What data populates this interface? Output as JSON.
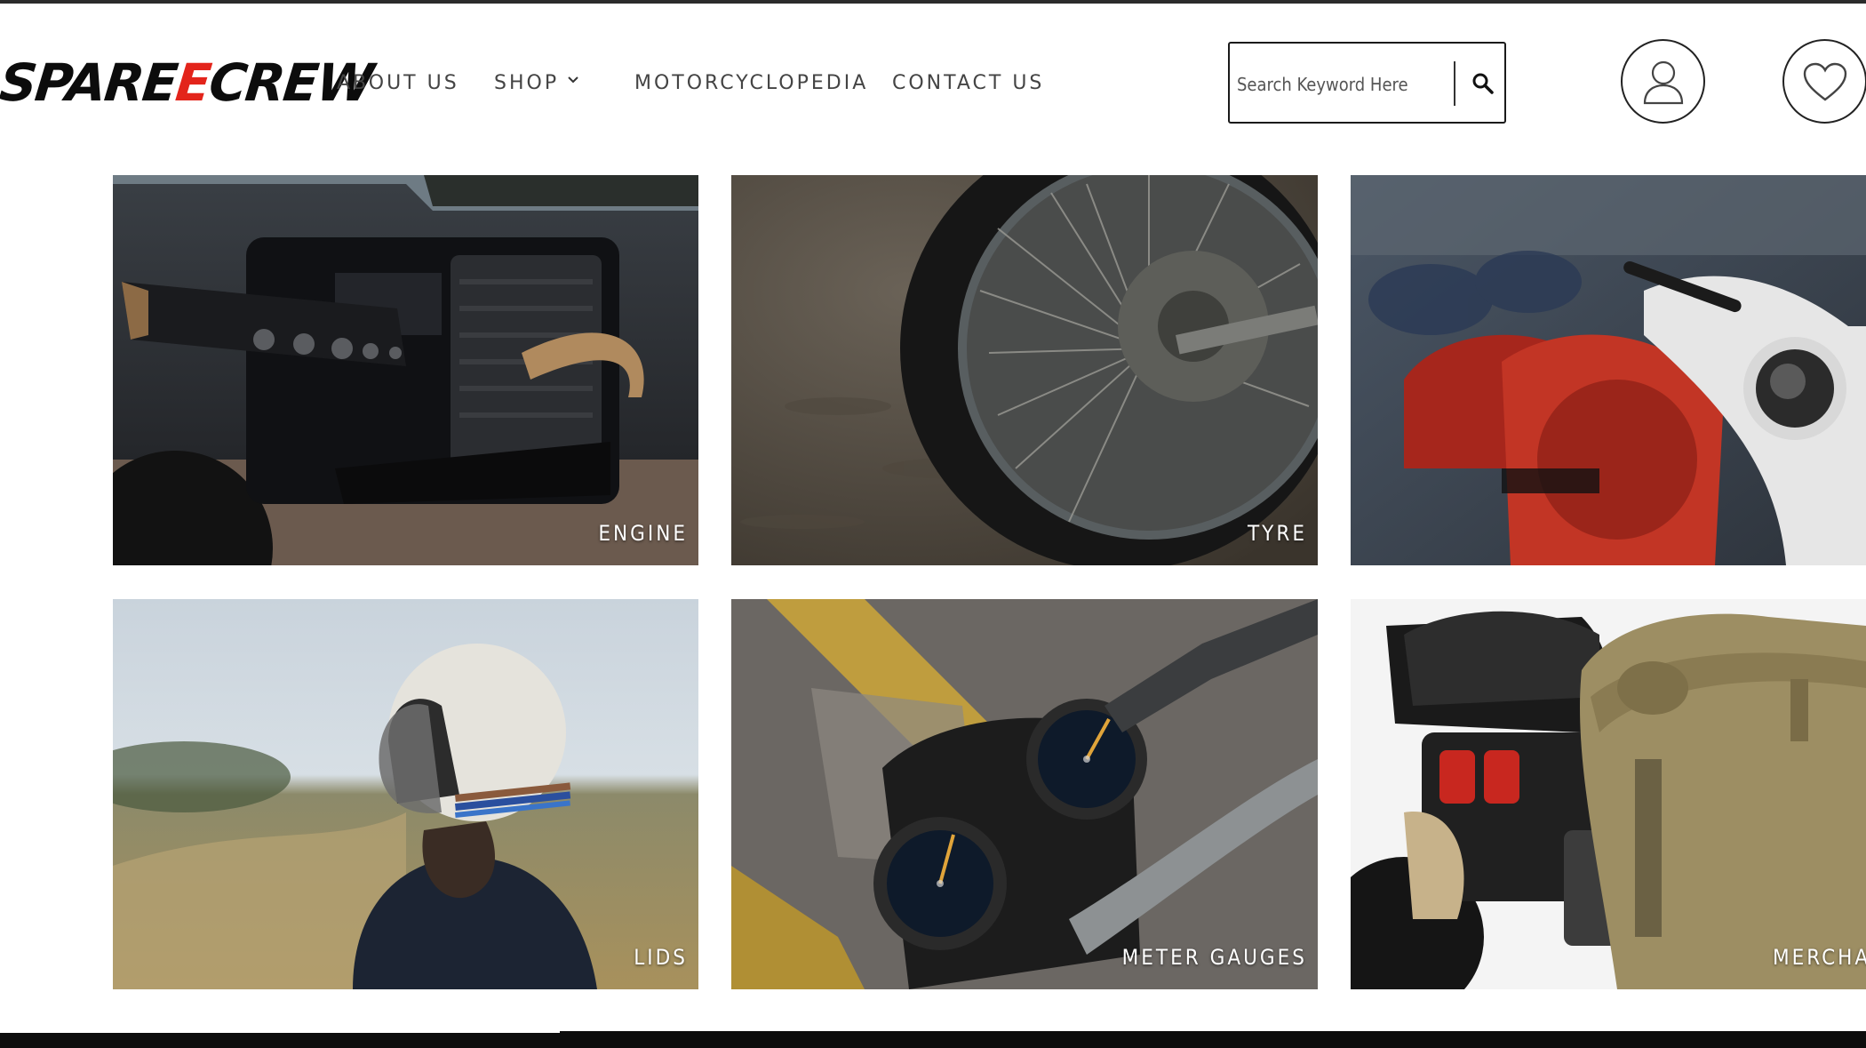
{
  "header": {
    "logo_prefix": "SPARE",
    "logo_accent": "E",
    "logo_suffix": "CREW",
    "nav": [
      {
        "label": "ABOUT US"
      },
      {
        "label": "SHOP"
      },
      {
        "label": "MOTORCYCLOPEDIA"
      },
      {
        "label": "CONTACT US"
      }
    ],
    "search": {
      "placeholder": "Search Keyword Here",
      "icon": "search-icon"
    },
    "account_icon": "user-icon",
    "wishlist_icon": "heart-icon"
  },
  "colors": {
    "brand_accent": "#e3241b",
    "text_dark": "#0c0c0c",
    "nav_text": "#444444",
    "tile_label": "#ffffff"
  },
  "categories": [
    {
      "label": "ENGINE"
    },
    {
      "label": "TYRE"
    },
    {
      "label": ""
    },
    {
      "label": "LIDS"
    },
    {
      "label": "METER GAUGES"
    },
    {
      "label": "MERCHAN"
    }
  ]
}
